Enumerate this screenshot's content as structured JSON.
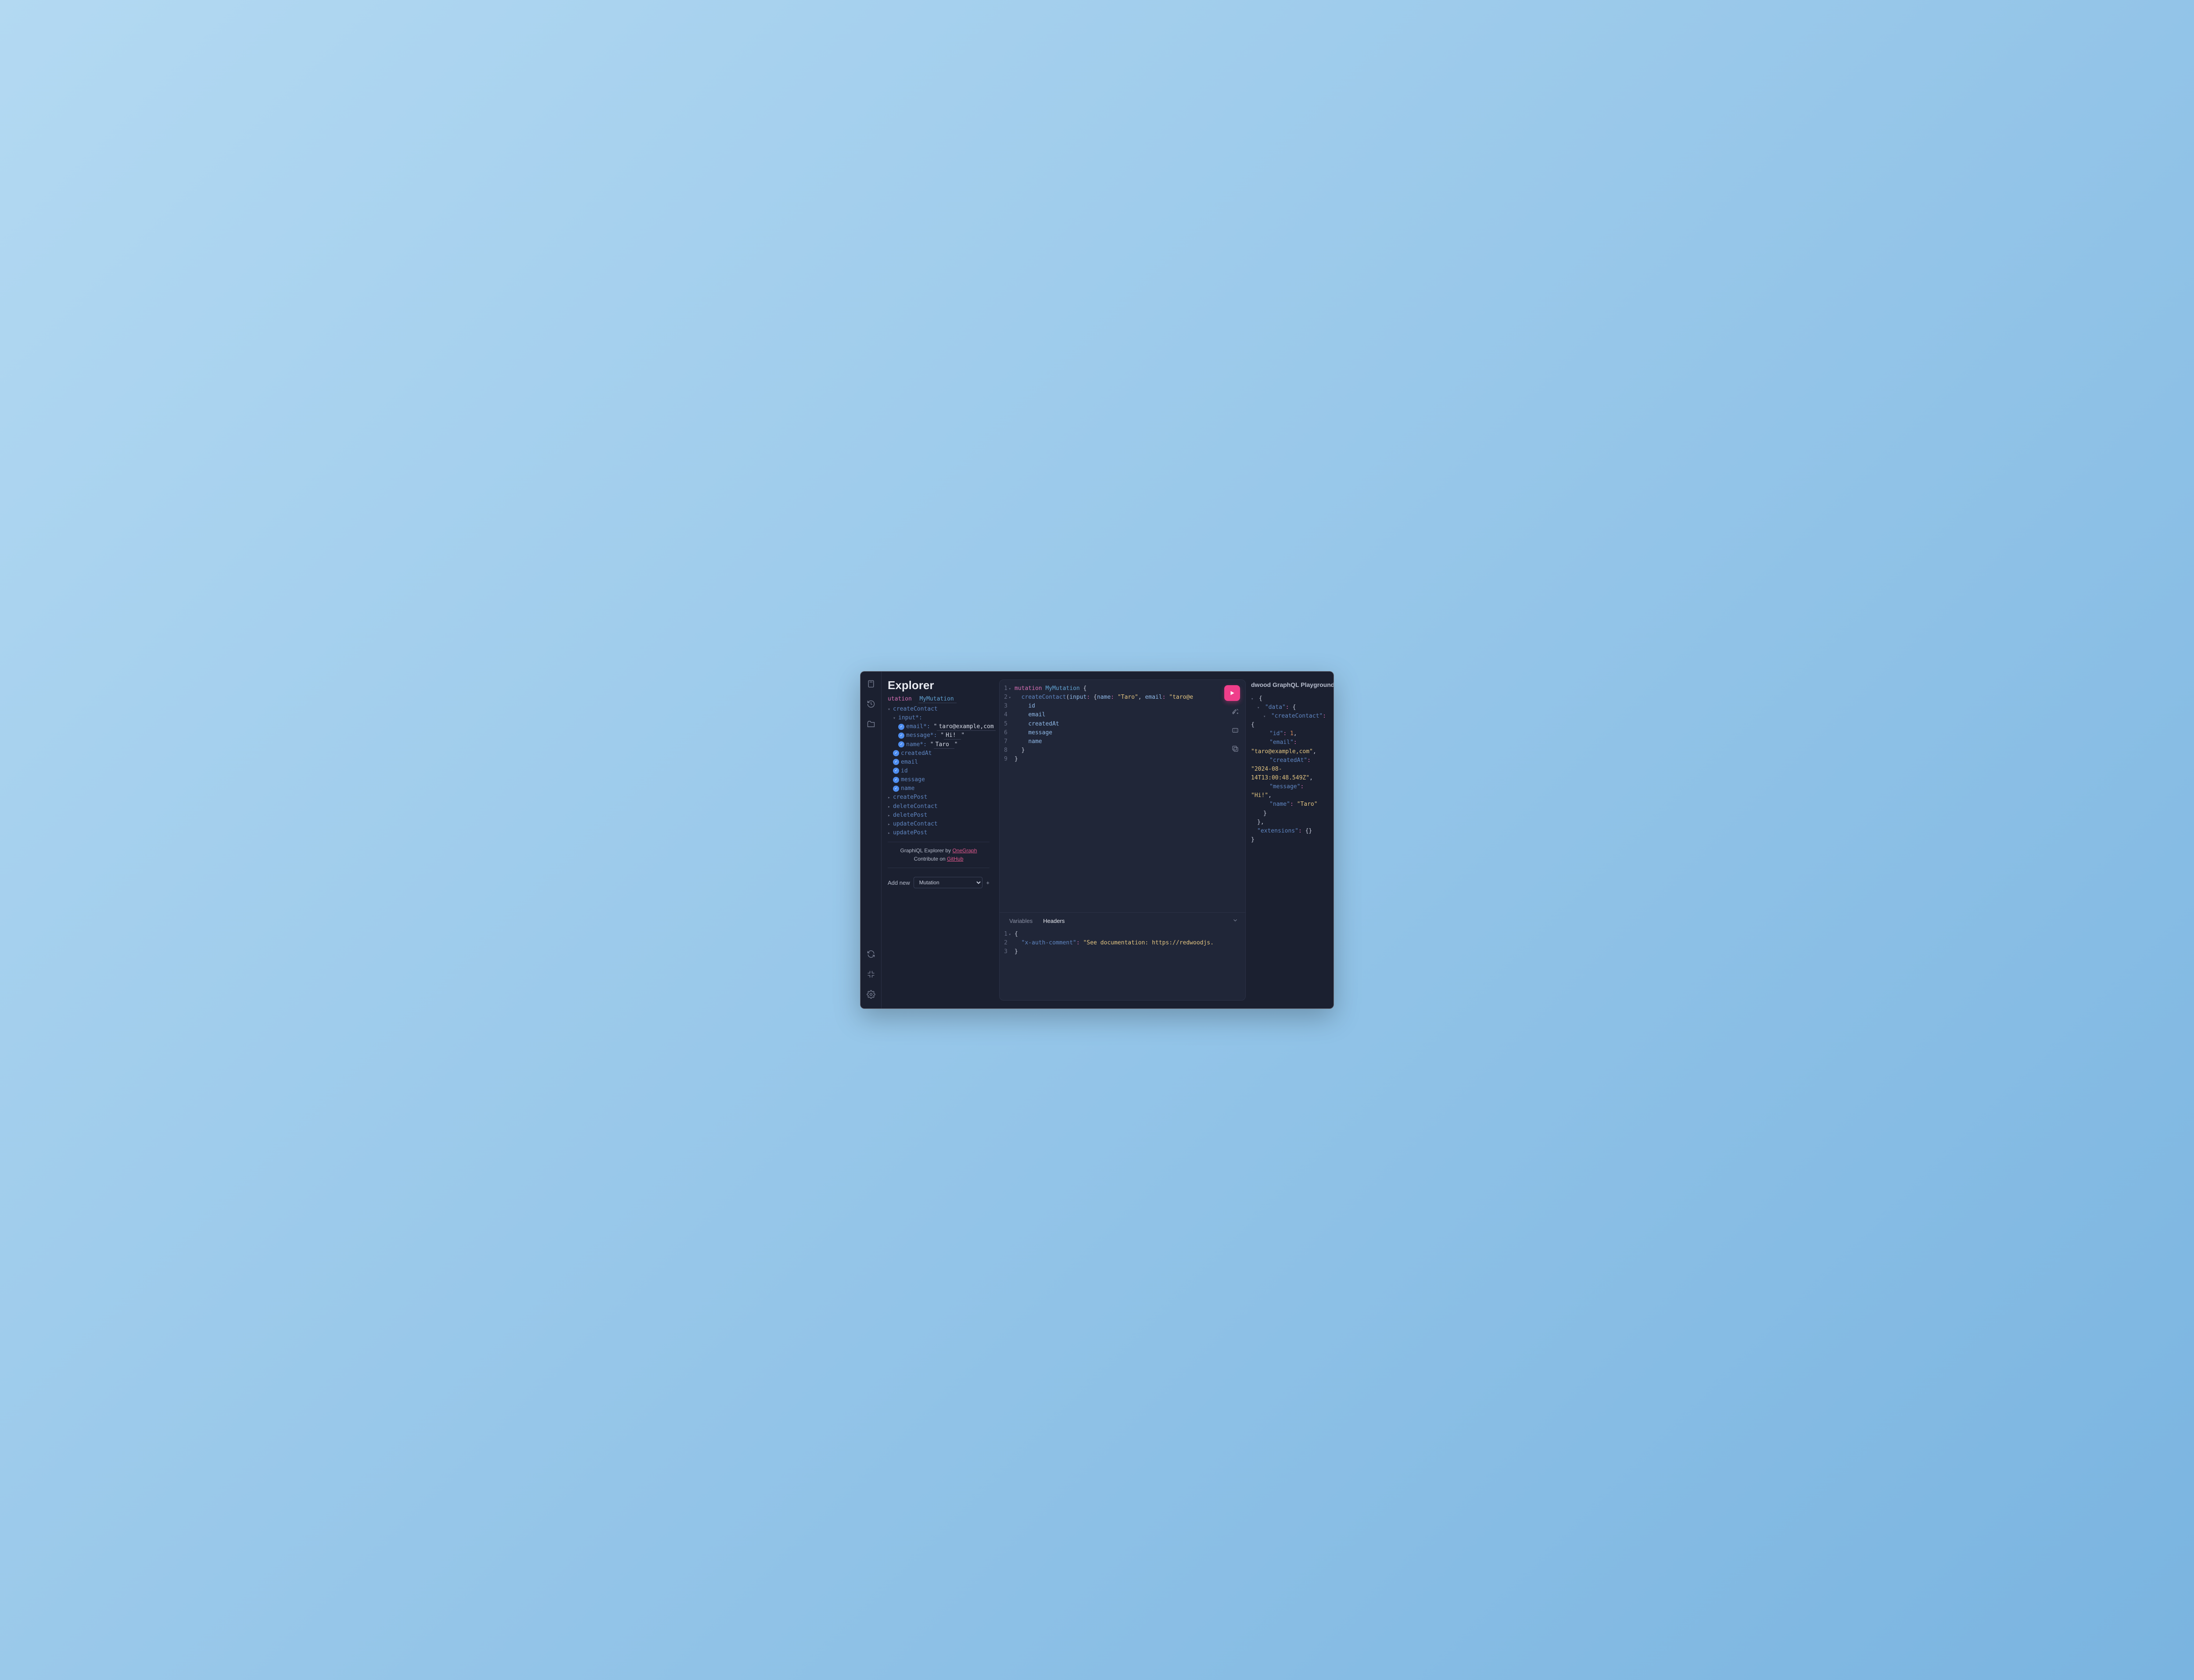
{
  "explorer": {
    "title": "Explorer",
    "op_type_partial": "utation",
    "op_name": "MyMutation",
    "createContact": {
      "label": "createContact",
      "input_label": "input*:",
      "fields": {
        "email": {
          "label": "email*:",
          "value": "taro@example,com"
        },
        "message": {
          "label": "message*:",
          "value": "Hi! "
        },
        "name": {
          "label": "name*:",
          "value": "Taro "
        }
      },
      "output_fields": [
        "createdAt",
        "email",
        "id",
        "message",
        "name"
      ]
    },
    "other_mutations": [
      "createPost",
      "deleteContact",
      "deletePost",
      "updateContact",
      "updatePost"
    ],
    "credit_prefix": "GraphiQL Explorer by ",
    "credit_link": "OneGraph",
    "contribute_prefix": "Contribute on ",
    "contribute_link": "GitHub",
    "add_new_label": "Add new",
    "add_new_options": [
      "Mutation"
    ]
  },
  "editor": {
    "lines": [
      {
        "n": 1,
        "fold": true,
        "tokens": [
          [
            "kw",
            "mutation "
          ],
          [
            "name",
            "MyMutation "
          ],
          [
            "punc",
            "{"
          ]
        ]
      },
      {
        "n": 2,
        "fold": true,
        "tokens": [
          [
            "punc",
            "  "
          ],
          [
            "fn",
            "createContact"
          ],
          [
            "punc",
            "("
          ],
          [
            "arg",
            "input"
          ],
          [
            "colon",
            ": "
          ],
          [
            "punc",
            "{"
          ],
          [
            "arg",
            "name"
          ],
          [
            "colon",
            ": "
          ],
          [
            "str",
            "\"Taro\""
          ],
          [
            "punc",
            ", "
          ],
          [
            "arg",
            "email"
          ],
          [
            "colon",
            ": "
          ],
          [
            "str",
            "\"taro@e"
          ]
        ]
      },
      {
        "n": 3,
        "tokens": [
          [
            "punc",
            "    "
          ],
          [
            "field",
            "id"
          ]
        ]
      },
      {
        "n": 4,
        "tokens": [
          [
            "punc",
            "    "
          ],
          [
            "field",
            "email"
          ]
        ]
      },
      {
        "n": 5,
        "tokens": [
          [
            "punc",
            "    "
          ],
          [
            "field",
            "createdAt"
          ]
        ]
      },
      {
        "n": 6,
        "tokens": [
          [
            "punc",
            "    "
          ],
          [
            "field",
            "message"
          ]
        ]
      },
      {
        "n": 7,
        "tokens": [
          [
            "punc",
            "    "
          ],
          [
            "field",
            "name"
          ]
        ]
      },
      {
        "n": 8,
        "tokens": [
          [
            "punc",
            "  }"
          ]
        ]
      },
      {
        "n": 9,
        "tokens": [
          [
            "punc",
            "}"
          ]
        ]
      }
    ]
  },
  "bottom_panel": {
    "tabs": {
      "variables": "Variables",
      "headers": "Headers",
      "active": "headers"
    },
    "headers_lines": [
      {
        "n": 1,
        "fold": true,
        "tokens": [
          [
            "punc",
            "{"
          ]
        ]
      },
      {
        "n": 2,
        "tokens": [
          [
            "punc",
            "  "
          ],
          [
            "key",
            "\"x-auth-comment\""
          ],
          [
            "colon",
            ": "
          ],
          [
            "str",
            "\"See documentation: https://redwoodjs."
          ]
        ]
      },
      {
        "n": 3,
        "tokens": [
          [
            "punc",
            "}"
          ]
        ]
      }
    ]
  },
  "result": {
    "title_visible": "dwood GraphQL Playground",
    "json": {
      "data": {
        "createContact": {
          "id": 1,
          "email": "taro@example,com",
          "createdAt": "2024-08-14T13:00:48.549Z",
          "message": "Hi!",
          "name": "Taro"
        }
      },
      "extensions": {}
    }
  }
}
